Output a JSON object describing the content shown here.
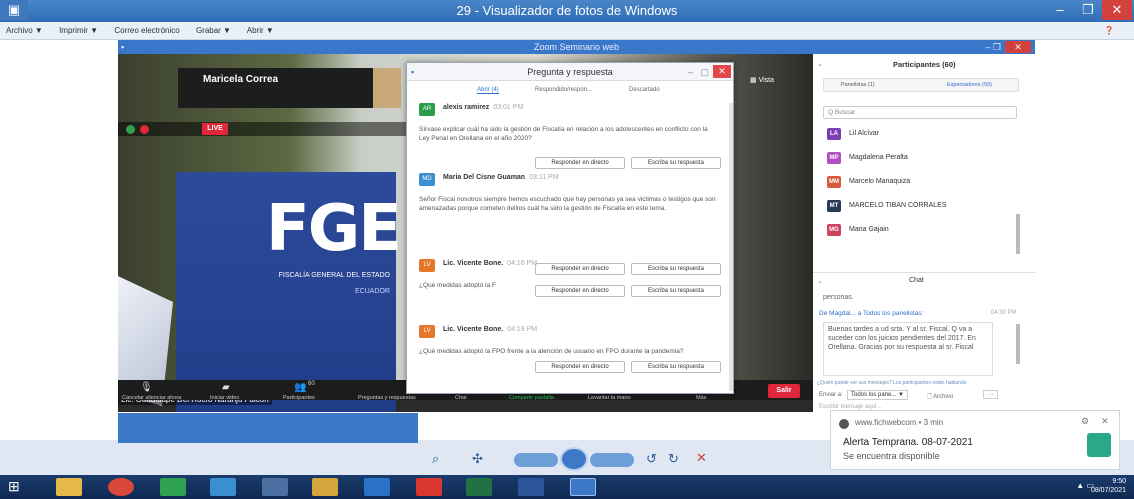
{
  "viewer": {
    "title": "29 - Visualizador de fotos de Windows",
    "menu": [
      "Archivo ▼",
      "Imprimir ▼",
      "Correo electrónico",
      "Grabar ▼",
      "Abrir ▼"
    ]
  },
  "zoom": {
    "window_title": "Zoom Seminario web",
    "presenter_name": "Maricela Correa",
    "vista_label": "Vista",
    "live_badge": "LIVE",
    "banner_logo": "FGE",
    "banner_sub1": "FISCALÍA GENERAL DEL ESTADO",
    "banner_sub2": "ECUADOR",
    "flag_text": "FGE",
    "speaker_label": "Lic. Guadalupe Del Rocío Naranjo Falcón",
    "toolbar": [
      "Cancelar silenciar ahora",
      "Iniciar video",
      "Participantes",
      "Preguntas y respuestas",
      "Chat",
      "Compartir pantalla",
      "Levantar la mano",
      "Más"
    ],
    "participants_count": "60",
    "leave_label": "Salir"
  },
  "qa": {
    "title": "Pregunta y respuesta",
    "tabs": [
      "Abrir (4)",
      "Respondido/respon...",
      "Descartado"
    ],
    "items": [
      {
        "initials": "AR",
        "color": "#2a9d4a",
        "name": "alexis ramirez",
        "time": "03:01 PM",
        "text": "Sírvase explicar cuál ha sido la gestión de Fiscalía en relación a los adolescentes en conflicto con la Ley Penal en Orellana en el año 2020?"
      },
      {
        "initials": "MD",
        "color": "#3a8fd1",
        "name": "Maria Del Cisne Guaman",
        "time": "03:11 PM",
        "text": "Señor Fiscal nosotros siempre hemos escuchado que hay personas ya sea victimas o testigos que son amenazadas porque cometen delitos cuál ha sido la gestión de Fiscalía en este tema."
      },
      {
        "initials": "LV",
        "color": "#e5762a",
        "name": "Lic. Vicente Bone.",
        "time": "04:16 PM",
        "text": "¿Qué medidas adoptó la F"
      },
      {
        "initials": "LV",
        "color": "#e5762a",
        "name": "Lic. Vicente Bone.",
        "time": "04:19 PM",
        "text": "¿Qué medidas adoptó la FPO frente a la atención de usuario en FPO durante la pandemia?"
      }
    ],
    "btn_live": "Responder en directo",
    "btn_write": "Escriba su respuesta"
  },
  "panel": {
    "title": "Participantes (60)",
    "tab_panelists": "Panelistas (1)",
    "tab_attendees": "Espectadores (59)",
    "search_placeholder": "Q Buscar",
    "people": [
      {
        "initials": "LA",
        "color": "#7b3fb5",
        "name": "Lil Alcívar"
      },
      {
        "initials": "MP",
        "color": "#b04ec2",
        "name": "Magdalena Peralta"
      },
      {
        "initials": "MM",
        "color": "#d85a3a",
        "name": "Marcelo Manaquiza"
      },
      {
        "initials": "MT",
        "color": "#2a3b55",
        "name": "MARCELO TIBAN CORRALES"
      },
      {
        "initials": "MG",
        "color": "#d04160",
        "name": "Maria Gajain"
      }
    ],
    "chat_title": "Chat",
    "chat_prev": "personas.",
    "chat_from": "De Magdal... a Todos los panelistas:",
    "chat_time": "04:30 PM",
    "chat_message": "Buenas tardes a ud srta. Y al sr. Fiscal. Q va a suceder con los juicios pendientes del 2017. En Orellana. Gracias por su respuesta al sr. Fiscal",
    "chat_notice": "¿Quién puede ver sus mensajes? Los participantes están hablando",
    "send_to_label": "Enviar a:",
    "send_to_value": "Todos los pane... ▼",
    "file_label": "Archivo",
    "more_label": "···",
    "input_placeholder": "Escribir mensaje aquí..."
  },
  "toast": {
    "source": "www.fichwebcom • 3 min",
    "title": "Alerta Temprana. 08-07-2021",
    "body": "Se encuentra disponible"
  },
  "clock": {
    "time": "9:50",
    "date": "08/07/2021"
  }
}
